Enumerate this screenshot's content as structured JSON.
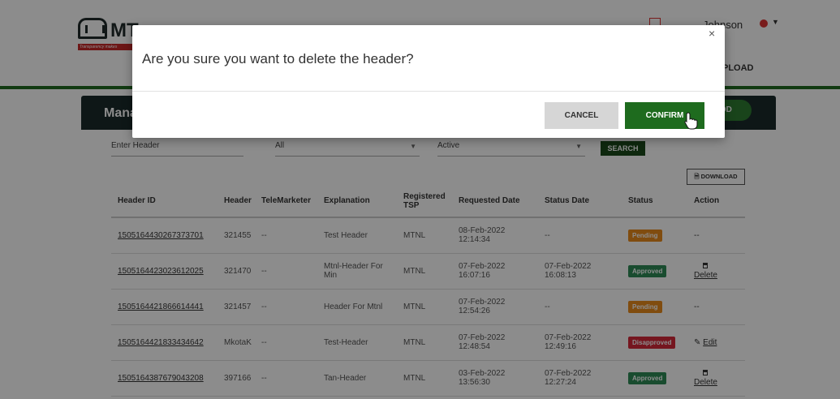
{
  "brand": {
    "logo_text": "MT",
    "tagline": "Transparency makes"
  },
  "header": {
    "user_name": "Johnson",
    "nav_upload": "PLOAD"
  },
  "card": {
    "title": "Mana",
    "add_label": "ADD"
  },
  "filters": {
    "header_placeholder": "Enter Header",
    "telemarketer_value": "All",
    "status_value": "Active",
    "search_label": "SEARCH",
    "download_label": "DOWNLOAD"
  },
  "table": {
    "columns": [
      "Header ID",
      "Header",
      "TeleMarketer",
      "Explanation",
      "Registered TSP",
      "Requested Date",
      "Status Date",
      "Status",
      "Action"
    ],
    "rows": [
      {
        "id": "1505164430267373701",
        "header": "321455",
        "tele": "--",
        "explanation": "Test Header",
        "tsp": "MTNL",
        "req_date": "08-Feb-2022",
        "req_time": "12:14:34",
        "status_date": "--",
        "status_time": "",
        "status": "Pending",
        "action": "--"
      },
      {
        "id": "1505164423023612025",
        "header": "321470",
        "tele": "--",
        "explanation": "Mtnl-Header For Min",
        "tsp": "MTNL",
        "req_date": "07-Feb-2022",
        "req_time": "16:07:16",
        "status_date": "07-Feb-2022",
        "status_time": "16:08:13",
        "status": "Approved",
        "action": "Delete"
      },
      {
        "id": "1505164421866614441",
        "header": "321457",
        "tele": "--",
        "explanation": "Header For Mtnl",
        "tsp": "MTNL",
        "req_date": "07-Feb-2022",
        "req_time": "12:54:26",
        "status_date": "--",
        "status_time": "",
        "status": "Pending",
        "action": "--"
      },
      {
        "id": "1505164421833434642",
        "header": "MkotaK",
        "tele": "--",
        "explanation": "Test-Header",
        "tsp": "MTNL",
        "req_date": "07-Feb-2022",
        "req_time": "12:48:54",
        "status_date": "07-Feb-2022",
        "status_time": "12:49:16",
        "status": "Disapproved",
        "action": "Edit"
      },
      {
        "id": "1505164387679043208",
        "header": "397166",
        "tele": "--",
        "explanation": "Tan-Header",
        "tsp": "MTNL",
        "req_date": "03-Feb-2022",
        "req_time": "13:56:30",
        "status_date": "07-Feb-2022",
        "status_time": "12:27:24",
        "status": "Approved",
        "action": "Delete"
      }
    ]
  },
  "modal": {
    "close_glyph": "×",
    "message": "Are you sure you want to delete the header?",
    "cancel_label": "CANCEL",
    "confirm_label": "CONFIRM"
  },
  "colors": {
    "brand_green": "#1e6b1e",
    "header_dark": "#1a2a2a",
    "pending": "#e98a1d",
    "approved": "#2e8b57",
    "disapproved": "#d62839"
  },
  "icons": {
    "close": "close-icon",
    "download": "download-icon",
    "delete": "trash-icon",
    "edit": "edit-icon",
    "cursor": "hand-pointer-icon"
  }
}
